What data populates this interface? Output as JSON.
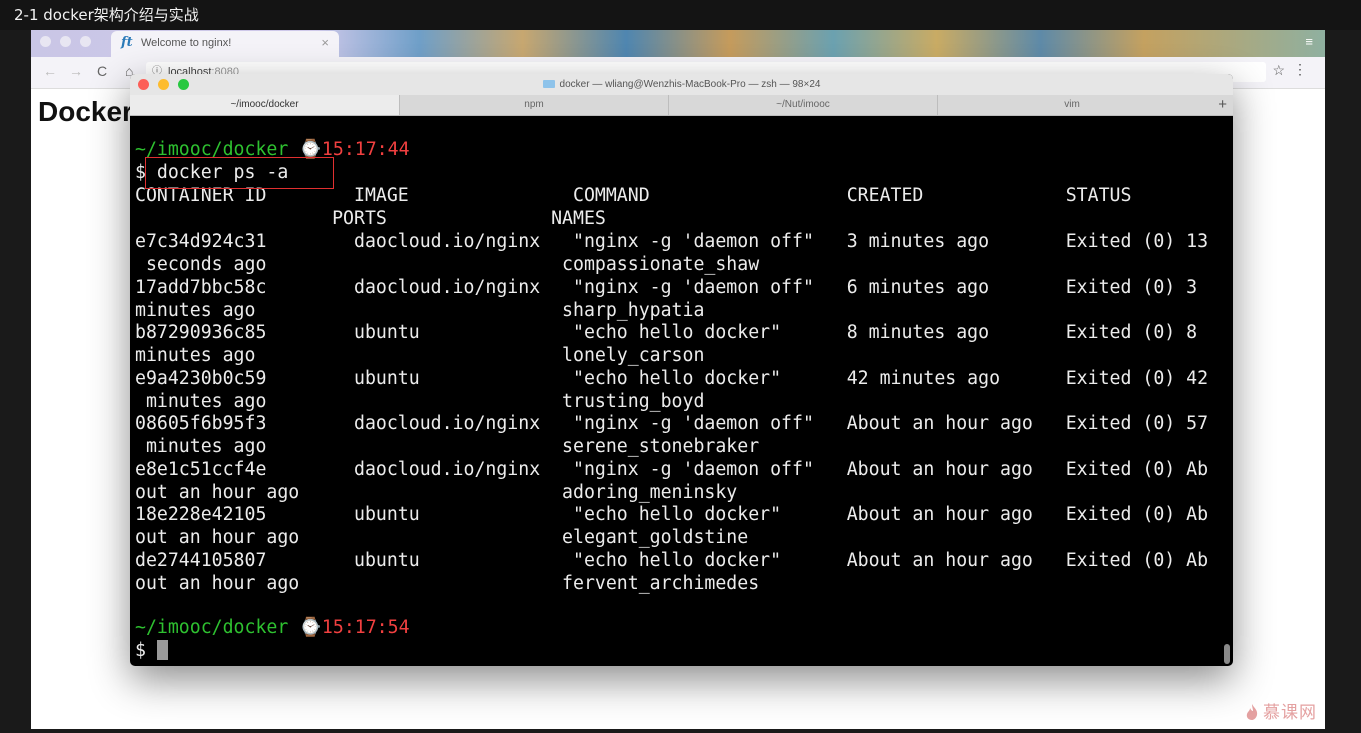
{
  "video": {
    "title": "2-1 docker架构介绍与实战"
  },
  "browser": {
    "tab_title": "Welcome to nginx!",
    "tab_icon": "ft",
    "tab_close": "×",
    "menu_icon": "≡",
    "nav_back": "←",
    "nav_forward": "→",
    "nav_reload": "C",
    "nav_home": "⌂",
    "info_icon": "ⓘ",
    "url_host": "localhost",
    "url_port": ":8080",
    "star": "☆",
    "dots": "⋮",
    "page_heading": "Docker",
    "watermark": "慕课网"
  },
  "terminal": {
    "title": "docker — wliang@Wenzhis-MacBook-Pro — zsh — 98×24",
    "tabs": [
      "~/imooc/docker",
      "npm",
      "~/Nut/imooc",
      "vim"
    ],
    "new_tab": "+",
    "prompt1": {
      "path": "~/imooc/docker",
      "icon": "⌚",
      "time": "15:17:44"
    },
    "command": "$ docker ps -a",
    "lines": [
      "CONTAINER ID        IMAGE               COMMAND                  CREATED             STATUS",
      "                  PORTS               NAMES",
      "e7c34d924c31        daocloud.io/nginx   \"nginx -g 'daemon off\"   3 minutes ago       Exited (0) 13",
      " seconds ago                           compassionate_shaw",
      "17add7bbc58c        daocloud.io/nginx   \"nginx -g 'daemon off\"   6 minutes ago       Exited (0) 3",
      "minutes ago                            sharp_hypatia",
      "b87290936c85        ubuntu              \"echo hello docker\"      8 minutes ago       Exited (0) 8",
      "minutes ago                            lonely_carson",
      "e9a4230b0c59        ubuntu              \"echo hello docker\"      42 minutes ago      Exited (0) 42",
      " minutes ago                           trusting_boyd",
      "08605f6b95f3        daocloud.io/nginx   \"nginx -g 'daemon off\"   About an hour ago   Exited (0) 57",
      " minutes ago                           serene_stonebraker",
      "e8e1c51ccf4e        daocloud.io/nginx   \"nginx -g 'daemon off\"   About an hour ago   Exited (0) Ab",
      "out an hour ago                        adoring_meninsky",
      "18e228e42105        ubuntu              \"echo hello docker\"      About an hour ago   Exited (0) Ab",
      "out an hour ago                        elegant_goldstine",
      "de2744105807        ubuntu              \"echo hello docker\"      About an hour ago   Exited (0) Ab",
      "out an hour ago                        fervent_archimedes"
    ],
    "prompt2": {
      "path": "~/imooc/docker",
      "icon": "⌚",
      "time": "15:17:54"
    },
    "final_prompt": "$ "
  },
  "colors": {
    "prompt_path": "#2ec130",
    "prompt_time": "#f14040",
    "highlight_box": "#e03030",
    "terminal_bg": "#000000"
  }
}
